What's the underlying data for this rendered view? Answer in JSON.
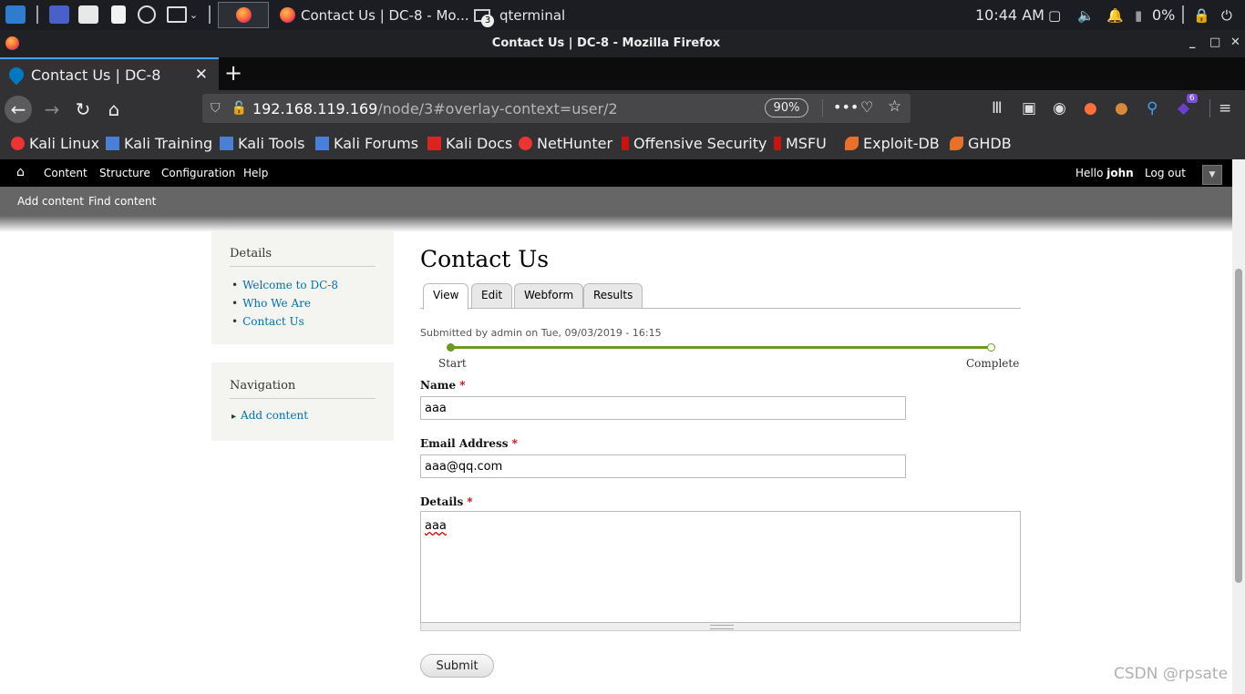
{
  "taskbar": {
    "tasks": [
      {
        "label": "Contact Us | DC-8 - Mo..."
      },
      {
        "label": "qterminal",
        "badge": "3"
      }
    ],
    "clock": "10:44 AM",
    "battery": "0%"
  },
  "window": {
    "title": "Contact Us | DC-8 - Mozilla Firefox",
    "controls": [
      "_",
      "□",
      "✕"
    ]
  },
  "browser": {
    "tab_label": "Contact Us | DC-8",
    "tab_close": "✕",
    "new_tab": "+",
    "url_host": "192.168.119.169",
    "url_path": "/node/3#overlay-context=user/2",
    "zoom": "90%",
    "extension_badge": "6"
  },
  "bookmarks": [
    {
      "label": "Kali Linux",
      "icon": "kali-dragon-icon"
    },
    {
      "label": "Kali Training",
      "icon": "kali-tool-icon"
    },
    {
      "label": "Kali Tools",
      "icon": "kali-tool-icon"
    },
    {
      "label": "Kali Forums",
      "icon": "kali-tool-icon"
    },
    {
      "label": "Kali Docs",
      "icon": "docs-icon"
    },
    {
      "label": "NetHunter",
      "icon": "kali-dragon-icon"
    },
    {
      "label": "Offensive Security",
      "icon": "offsec-icon"
    },
    {
      "label": "MSFU",
      "icon": "offsec-icon"
    },
    {
      "label": "Exploit-DB",
      "icon": "exploitdb-icon"
    },
    {
      "label": "GHDB",
      "icon": "exploitdb-icon"
    }
  ],
  "toolbar": {
    "items": [
      "Content",
      "Structure",
      "Configuration",
      "Help"
    ],
    "hello": "Hello",
    "user": "john",
    "logout": "Log out"
  },
  "shortcuts": [
    "Add content",
    "Find content"
  ],
  "sidebar": {
    "details_title": "Details",
    "details_links": [
      "Welcome to DC-8",
      "Who We Are",
      "Contact Us"
    ],
    "nav_title": "Navigation",
    "nav_links": [
      "Add content"
    ]
  },
  "page": {
    "title": "Contact Us",
    "tabs": [
      "View",
      "Edit",
      "Webform",
      "Results"
    ],
    "submitted": "Submitted by admin on Tue, 09/03/2019 - 16:15",
    "progress_start": "Start",
    "progress_end": "Complete",
    "required_marker": "*",
    "name_label": "Name",
    "name_value": "aaa",
    "email_label": "Email Address",
    "email_value": "aaa@qq.com",
    "details_label": "Details",
    "details_value": "aaa",
    "submit": "Submit"
  },
  "watermark": "CSDN @rpsate",
  "colors": {
    "link": "#0071b3",
    "progress": "#6a9a24",
    "required": "#cc0000",
    "firefox_accent": "#45a1ff"
  }
}
